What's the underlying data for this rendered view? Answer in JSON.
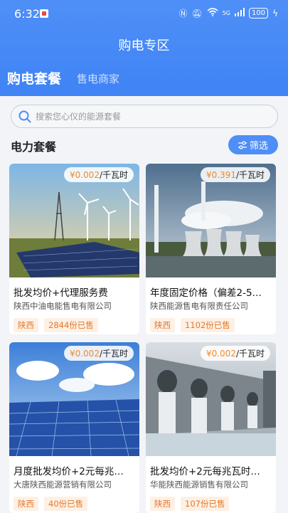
{
  "status_bar": {
    "time": "6:32",
    "battery": "100",
    "network": "5G"
  },
  "header": {
    "title": "购电专区"
  },
  "tabs": [
    {
      "label": "购电套餐"
    },
    {
      "label": "售电商家"
    }
  ],
  "search": {
    "placeholder": "搜索您心仪的能源套餐"
  },
  "section": {
    "title": "电力套餐",
    "filter_label": "筛选"
  },
  "price_unit": "/千瓦时",
  "currency": "¥",
  "products": [
    {
      "price": "0.002",
      "name": "批发均价+代理服务费",
      "company": "陕西中油电能售电有限公司",
      "region": "陕西",
      "sold": "2844份已售",
      "image": "wind-solar-farm"
    },
    {
      "price": "0.391",
      "name": "年度固定价格（偏差2-5…",
      "company": "陕西能源售电有限责任公司",
      "region": "陕西",
      "sold": "1102份已售",
      "image": "power-plant"
    },
    {
      "price": "0.002",
      "name": "月度批发均价+2元每兆…",
      "company": "大唐陕西能源营销有限公司",
      "region": "陕西",
      "sold": "40份已售",
      "image": "solar-panels"
    },
    {
      "price": "0.002",
      "name": "批发均价+2元每兆瓦时…",
      "company": "华能陕西能源销售有限公司",
      "region": "陕西",
      "sold": "107份已售",
      "image": "hydro-dam"
    }
  ],
  "colors": {
    "primary": "#4e8ef7",
    "accent": "#f08a2a"
  }
}
